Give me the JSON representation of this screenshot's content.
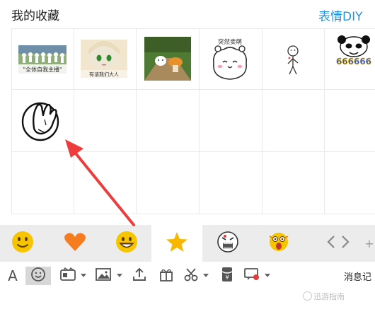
{
  "header": {
    "title": "我的收藏",
    "diy_link": "表情DIY"
  },
  "stickers": [
    {
      "caption": "\"全体自我主播\"",
      "name": "crowd-meme"
    },
    {
      "caption": "有请我们大人",
      "name": "anime-girl"
    },
    {
      "caption": "",
      "name": "forest-mushroom"
    },
    {
      "caption": "突然卖萌",
      "name": "cute-bear"
    },
    {
      "caption": "",
      "name": "stick-figure"
    },
    {
      "caption": "666666",
      "name": "panda-666"
    },
    {
      "caption": "",
      "name": "facepalm"
    }
  ],
  "tabs": [
    {
      "name": "tab-classic-emoji",
      "icon": "smiley-face-icon",
      "color": "#f7c500"
    },
    {
      "name": "tab-heart",
      "icon": "heart-icon",
      "color": "#f57c1f"
    },
    {
      "name": "tab-emoji",
      "icon": "grin-face-icon",
      "color": "#f7c500"
    },
    {
      "name": "tab-favorites",
      "icon": "star-icon",
      "color": "#f7b600",
      "active": true
    },
    {
      "name": "tab-rage-face",
      "icon": "rage-face-icon"
    },
    {
      "name": "tab-shock-face",
      "icon": "shocked-face-icon"
    }
  ],
  "toolbar": {
    "items": [
      "font",
      "emoji",
      "sticker-gif",
      "image",
      "upload-file",
      "gift",
      "screenshot",
      "red-envelope",
      "remote-chat"
    ],
    "message_history_label": "消息记"
  },
  "watermark": "迅游指南"
}
